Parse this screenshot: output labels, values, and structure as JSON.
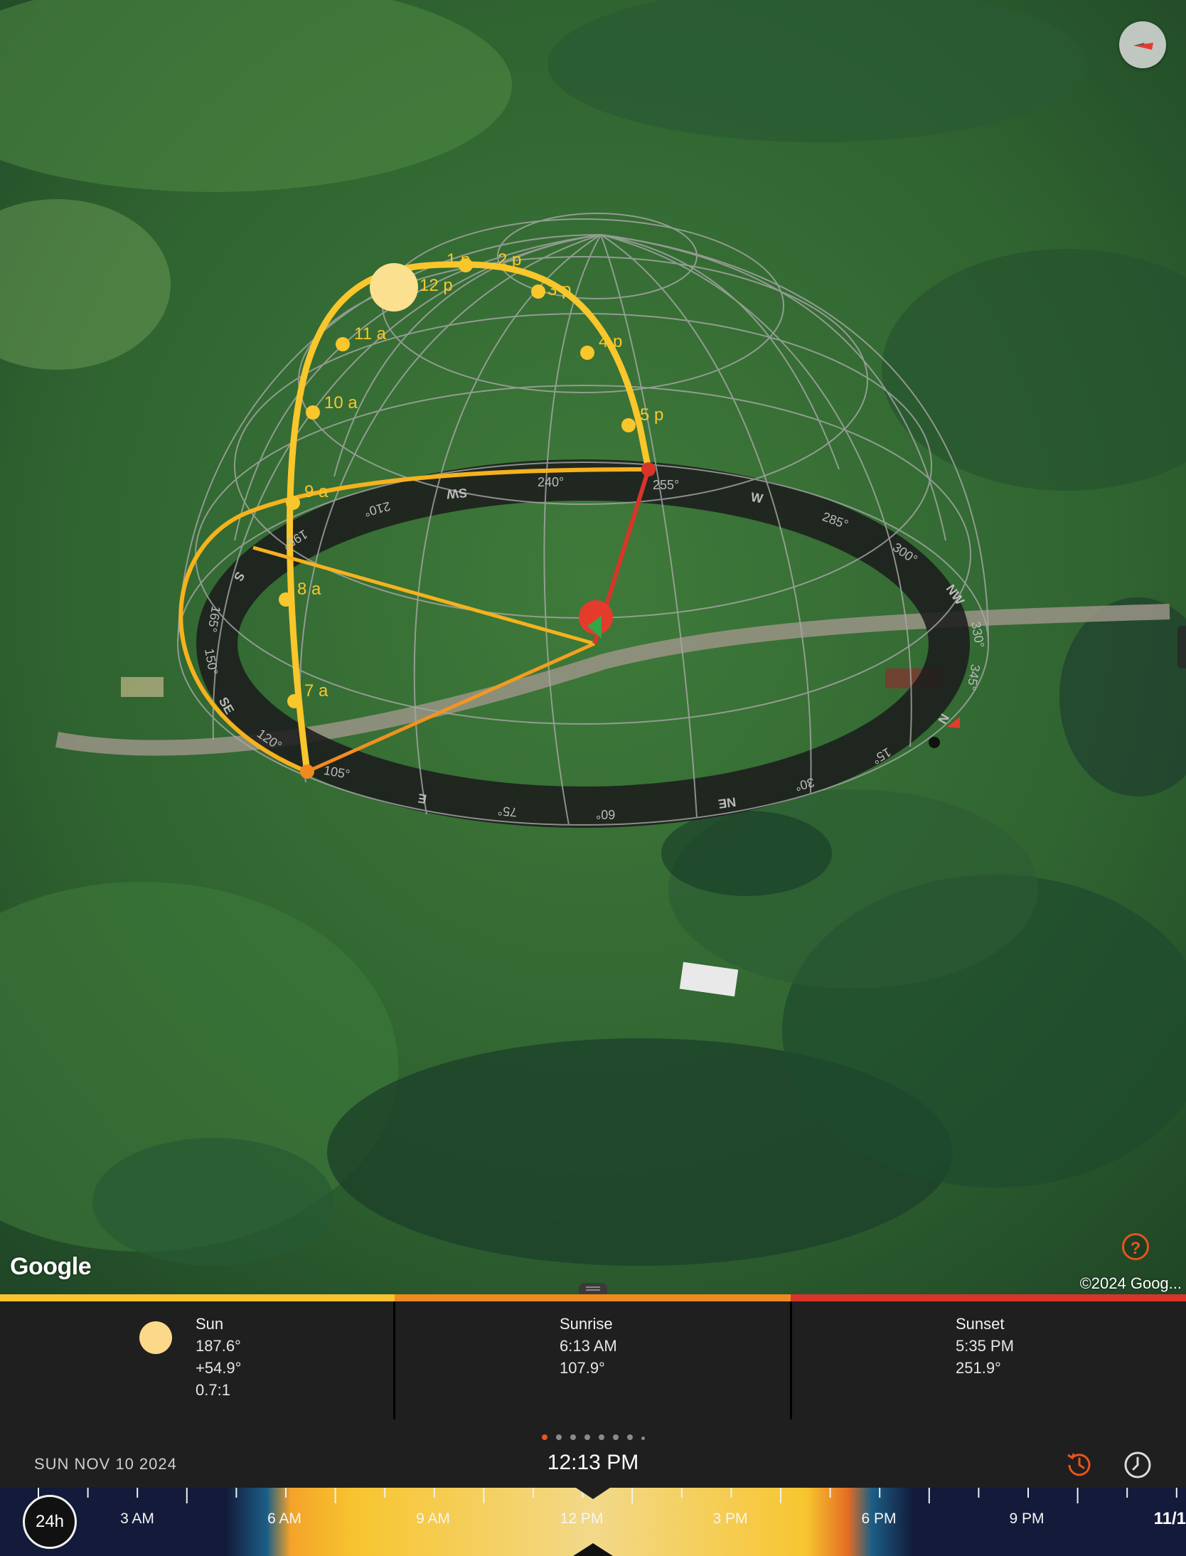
{
  "map": {
    "attribution_logo": "Google",
    "copyright": "©2024 Goog...",
    "help_label": "?",
    "hour_labels": [
      "7 a",
      "8 a",
      "9 a",
      "10 a",
      "11 a",
      "12 p",
      "1 p",
      "2 p",
      "3 p",
      "4 p",
      "5 p"
    ],
    "ring_labels": [
      "105°",
      "120°",
      "SE",
      "150°",
      "165°",
      "S",
      "195°",
      "210°",
      "SW",
      "240°",
      "255°",
      "W",
      "285°",
      "300°",
      "NW",
      "330°",
      "345°",
      "N",
      "15°",
      "30°",
      "NE",
      "60°",
      "75°",
      "E"
    ]
  },
  "info": {
    "sun": {
      "title": "Sun",
      "azimuth": "187.6°",
      "elevation": "+54.9°",
      "ratio": "0.7:1"
    },
    "sunrise": {
      "title": "Sunrise",
      "time": "6:13 AM",
      "azimuth": "107.9°"
    },
    "sunset": {
      "title": "Sunset",
      "time": "5:35 PM",
      "azimuth": "251.9°"
    },
    "colors": {
      "sun": "#f7c32e",
      "sunrise": "#ef8a1f",
      "sunset": "#d8352a"
    }
  },
  "datebar": {
    "date": "SUN NOV 10 2024",
    "time": "12:13 PM",
    "page_dots": 8,
    "active_dot": 0
  },
  "timeline": {
    "mode_button": "24h",
    "labels": [
      "3 AM",
      "6 AM",
      "9 AM",
      "12 PM",
      "3 PM",
      "6 PM",
      "9 PM"
    ],
    "end_label": "11/1"
  }
}
